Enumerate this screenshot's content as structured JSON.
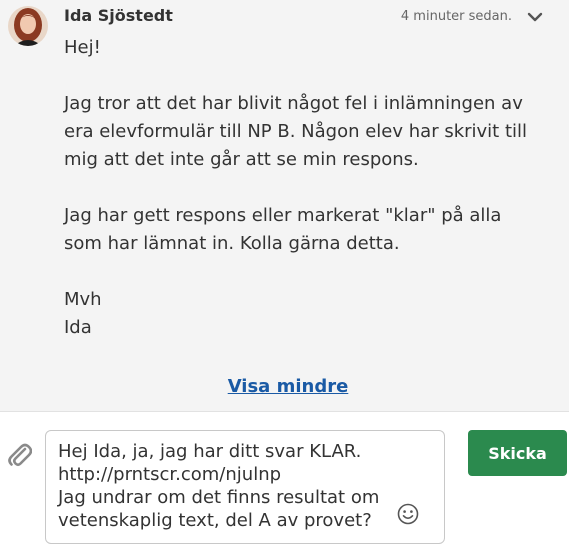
{
  "message": {
    "sender": "Ida Sjöstedt",
    "timestamp": "4 minuter sedan.",
    "body": {
      "greeting": "Hej!",
      "paragraph1": "Jag tror att det har blivit något fel i inlämningen av era elevformulär till NP B. Någon elev har skrivit till mig att det inte går att se min respons.",
      "paragraph2": "Jag har gett respons eller markerat \"klar\" på alla som har lämnat in. Kolla gärna detta.",
      "signoff": "Mvh",
      "signature": "Ida"
    },
    "show_less_label": "Visa mindre"
  },
  "reply": {
    "text": "Hej Ida, ja, jag har ditt svar KLAR.\nhttp://prntscr.com/njulnp\nJag undrar om det finns resultat om vetenskaplig text, del A av provet?"
  },
  "send_button_label": "Skicka",
  "icons": {
    "expand": "chevron-down-icon",
    "attach": "paperclip-icon",
    "emoji": "smiley-icon"
  },
  "colors": {
    "message_background": "#f4f4f4",
    "link": "#1a5aa5",
    "send_button": "#2b8a4e"
  }
}
